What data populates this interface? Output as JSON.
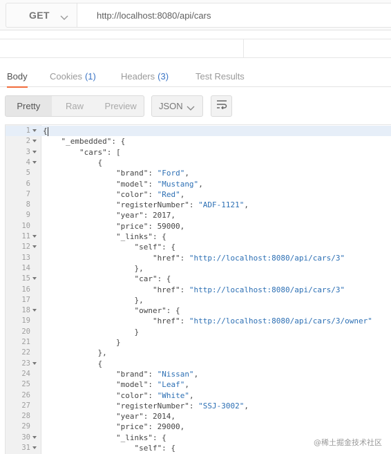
{
  "request": {
    "method": "GET",
    "url": "http://localhost:8080/api/cars"
  },
  "tabs": [
    {
      "label": "Body",
      "count": ""
    },
    {
      "label": "Cookies",
      "count": "(1)"
    },
    {
      "label": "Headers",
      "count": "(3)"
    },
    {
      "label": "Test Results",
      "count": ""
    }
  ],
  "view_modes": [
    "Pretty",
    "Raw",
    "Preview"
  ],
  "format": "JSON",
  "icons": {
    "method_dropdown": "chevron-down-icon",
    "format_dropdown": "chevron-down-icon",
    "wrap": "wrap-lines-icon",
    "fold": "fold-arrow-icon"
  },
  "colors": {
    "accent": "#f26b3a",
    "count": "#3a74c5",
    "string": "#2c6fb4"
  },
  "code_lines": [
    {
      "n": "1",
      "fold": true,
      "text": "{"
    },
    {
      "n": "2",
      "fold": true,
      "text": "    \"_embedded\": {"
    },
    {
      "n": "3",
      "fold": true,
      "text": "        \"cars\": ["
    },
    {
      "n": "4",
      "fold": true,
      "text": "            {"
    },
    {
      "n": "5",
      "fold": false,
      "text": "                \"brand\": \"Ford\","
    },
    {
      "n": "6",
      "fold": false,
      "text": "                \"model\": \"Mustang\","
    },
    {
      "n": "7",
      "fold": false,
      "text": "                \"color\": \"Red\","
    },
    {
      "n": "8",
      "fold": false,
      "text": "                \"registerNumber\": \"ADF-1121\","
    },
    {
      "n": "9",
      "fold": false,
      "text": "                \"year\": 2017,"
    },
    {
      "n": "10",
      "fold": false,
      "text": "                \"price\": 59000,"
    },
    {
      "n": "11",
      "fold": true,
      "text": "                \"_links\": {"
    },
    {
      "n": "12",
      "fold": true,
      "text": "                    \"self\": {"
    },
    {
      "n": "13",
      "fold": false,
      "text": "                        \"href\": \"http://localhost:8080/api/cars/3\""
    },
    {
      "n": "14",
      "fold": false,
      "text": "                    },"
    },
    {
      "n": "15",
      "fold": true,
      "text": "                    \"car\": {"
    },
    {
      "n": "16",
      "fold": false,
      "text": "                        \"href\": \"http://localhost:8080/api/cars/3\""
    },
    {
      "n": "17",
      "fold": false,
      "text": "                    },"
    },
    {
      "n": "18",
      "fold": true,
      "text": "                    \"owner\": {"
    },
    {
      "n": "19",
      "fold": false,
      "text": "                        \"href\": \"http://localhost:8080/api/cars/3/owner\""
    },
    {
      "n": "20",
      "fold": false,
      "text": "                    }"
    },
    {
      "n": "21",
      "fold": false,
      "text": "                }"
    },
    {
      "n": "22",
      "fold": false,
      "text": "            },"
    },
    {
      "n": "23",
      "fold": true,
      "text": "            {"
    },
    {
      "n": "24",
      "fold": false,
      "text": "                \"brand\": \"Nissan\","
    },
    {
      "n": "25",
      "fold": false,
      "text": "                \"model\": \"Leaf\","
    },
    {
      "n": "26",
      "fold": false,
      "text": "                \"color\": \"White\","
    },
    {
      "n": "27",
      "fold": false,
      "text": "                \"registerNumber\": \"SSJ-3002\","
    },
    {
      "n": "28",
      "fold": false,
      "text": "                \"year\": 2014,"
    },
    {
      "n": "29",
      "fold": false,
      "text": "                \"price\": 29000,"
    },
    {
      "n": "30",
      "fold": true,
      "text": "                \"_links\": {"
    },
    {
      "n": "31",
      "fold": true,
      "text": "                    \"self\": {"
    }
  ],
  "watermark": "@稀土掘金技术社区"
}
